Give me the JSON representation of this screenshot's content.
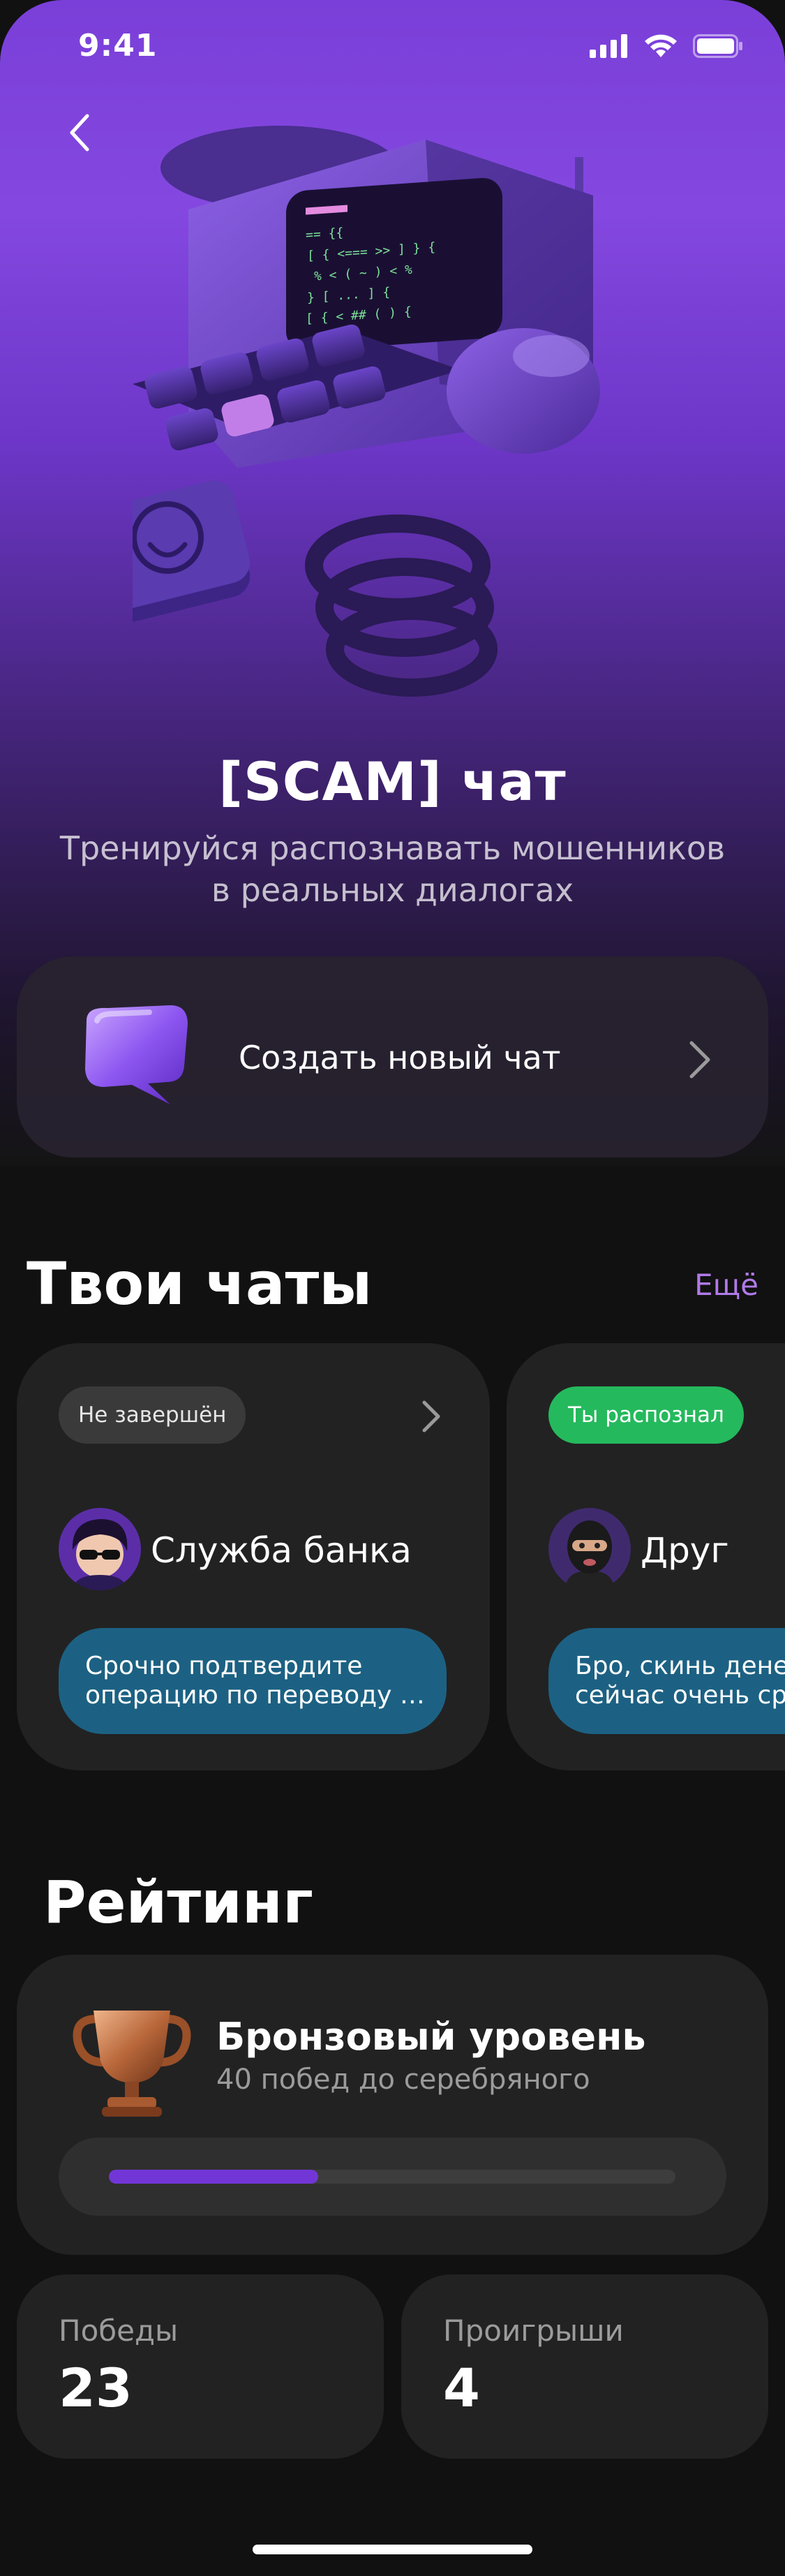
{
  "status_bar": {
    "time": "9:41",
    "icons": [
      "signal-icon",
      "wifi-icon",
      "battery-icon"
    ]
  },
  "hero": {
    "title": "[SCAM] чат",
    "subtitle_lines": [
      "Тренируйся распознавать мошенников",
      "в реальных диалогах"
    ]
  },
  "create_chat": {
    "label": "Создать новый чат",
    "icon": "chat-bubble-icon"
  },
  "chats_section": {
    "title": "Твои чаты",
    "more_label": "Ещё",
    "items": [
      {
        "status": "Не завершён",
        "status_color": "#3a3a3a",
        "name": "Служба банка",
        "message_lines": [
          "Срочно подтвердите",
          "операцию по переводу д..."
        ]
      },
      {
        "status": "Ты распознал",
        "status_color": "#25b95d",
        "name": "Друг",
        "message_lines": [
          "Бро, скинь денег",
          "сейчас очень сро"
        ]
      }
    ]
  },
  "rating_section": {
    "title": "Рейтинг",
    "level_title": "Бронзовый уровень",
    "level_subtitle": "40 побед до серебряного",
    "progress": 0.37,
    "accent_color": "#7236d6"
  },
  "stats": {
    "wins_label": "Победы",
    "wins_value": "23",
    "losses_label": "Проигрыши",
    "losses_value": "4"
  }
}
